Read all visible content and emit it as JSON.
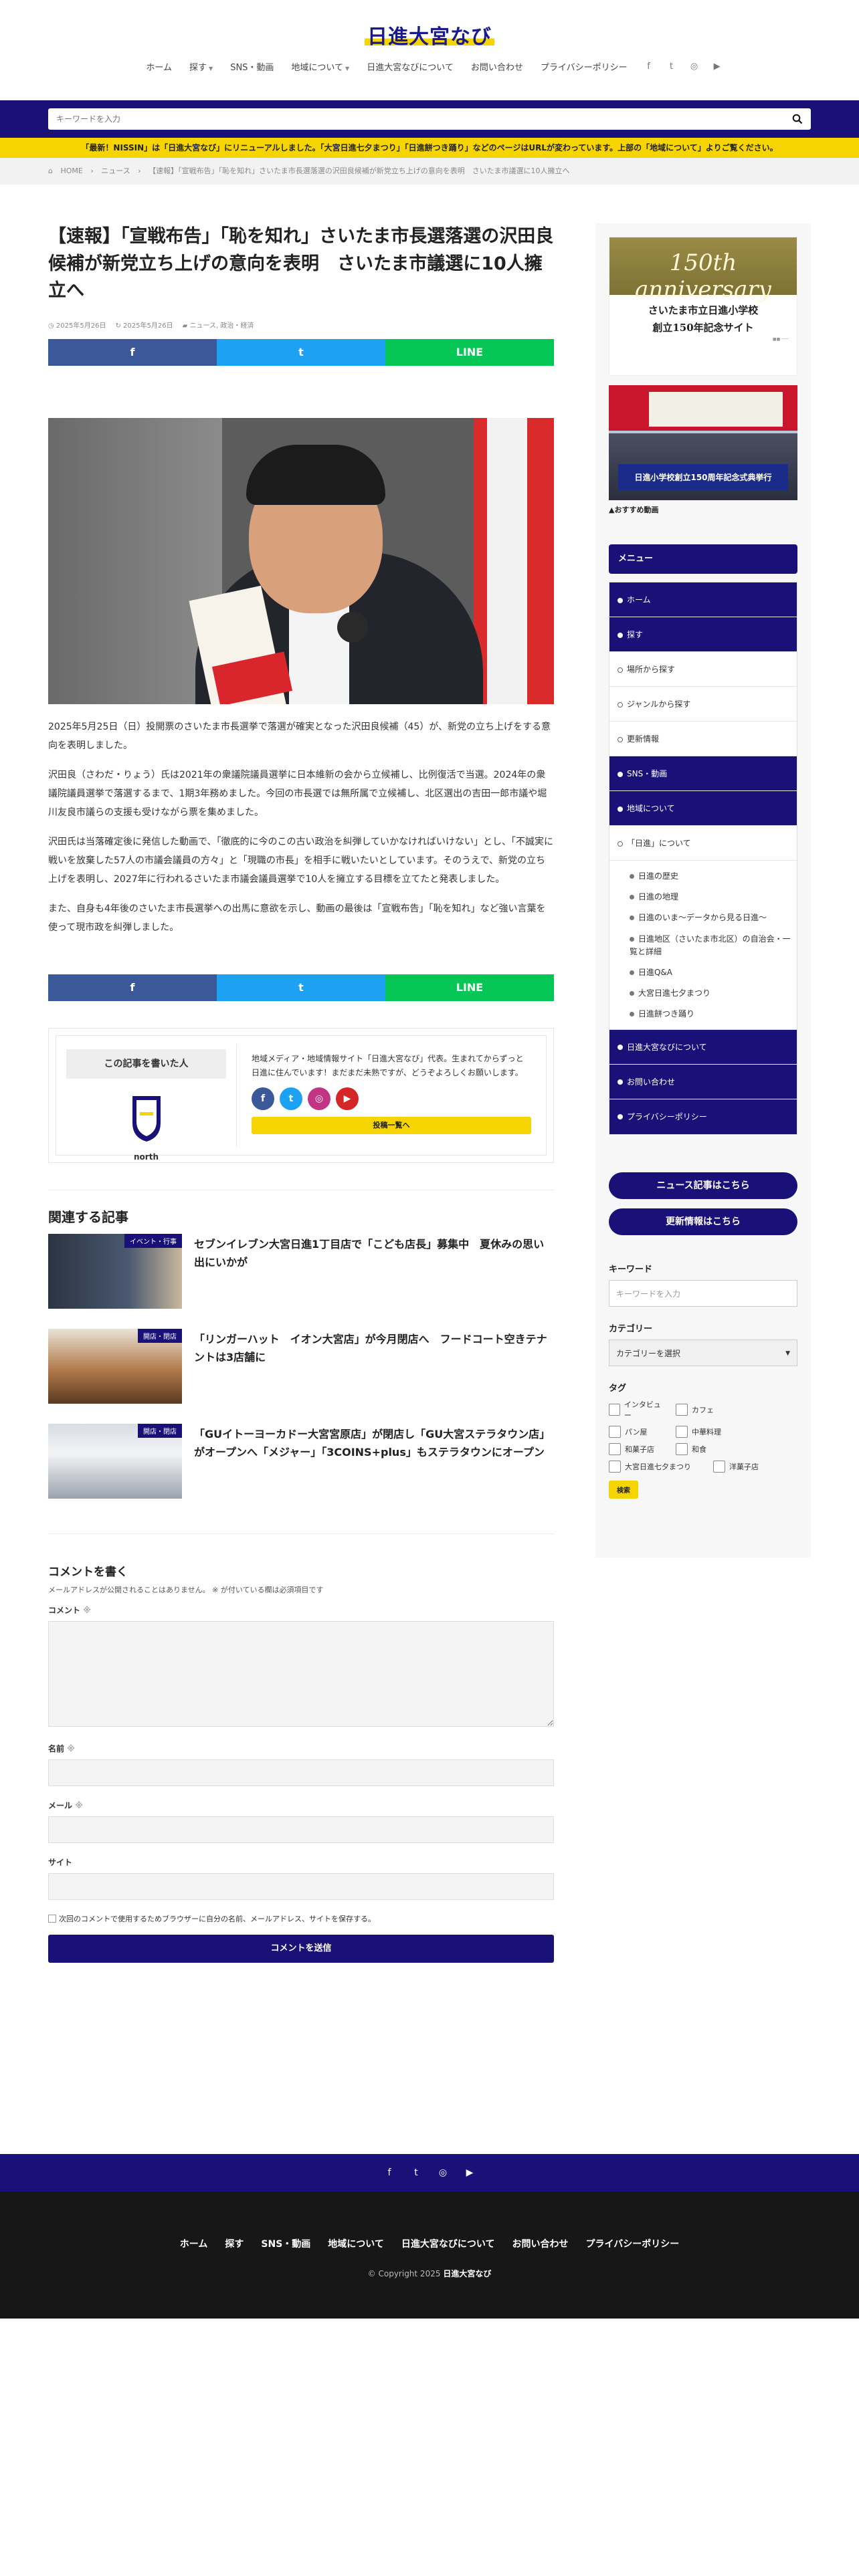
{
  "site": {
    "logo": "日進大宮なび",
    "nav": [
      "ホーム",
      "探す",
      "SNS・動画",
      "地域について",
      "日進大宮なびについて",
      "お問い合わせ",
      "プライバシーポリシー"
    ],
    "nav_has_dropdown": [
      false,
      true,
      false,
      true,
      false,
      false,
      false
    ],
    "sns_icons": [
      "facebook-icon",
      "twitter-icon",
      "instagram-icon",
      "youtube-icon"
    ]
  },
  "search": {
    "placeholder": "キーワードを入力"
  },
  "notice": "「最新！NISSIN」は「日進大宮なび」にリニューアルしました。「大宮日進七夕まつり」「日進餅つき踊り」などのページはURLが変わっています。上部の「地域について」よりご覧ください。",
  "breadcrumb": [
    "HOME",
    "ニュース",
    "【速報】「宣戦布告」「恥を知れ」さいたま市長選落選の沢田良候補が新党立ち上げの意向を表明　さいたま市議選に10人擁立へ"
  ],
  "article": {
    "title": "【速報】「宣戦布告」「恥を知れ」さいたま市長選落選の沢田良候補が新党立ち上げの意向を表明　さいたま市議選に10人擁立へ",
    "published": "2025年5月26日",
    "updated": "2025年5月26日",
    "category": "ニュース, 政治・経済",
    "paragraphs": [
      "2025年5月25日（日）投開票のさいたま市長選挙で落選が確実となった沢田良候補（45）が、新党の立ち上げをする意向を表明しました。",
      "沢田良（さわだ・りょう）氏は2021年の衆議院議員選挙に日本維新の会から立候補し、比例復活で当選。2024年の衆議院議員選挙で落選するまで、1期3年務めました。今回の市長選では無所属で立候補し、北区選出の吉田一郎市議や堀川友良市議らの支援も受けながら票を集めました。",
      "沢田氏は当落確定後に発信した動画で、「徹底的に今のこの古い政治を糾弾していかなければいけない」とし、「不誠実に戦いを放棄した57人の市議会議員の方々」と「現職の市長」を相手に戦いたいとしています。そのうえで、新党の立ち上げを表明し、2027年に行われるさいたま市議会議員選挙で10人を擁立する目標を立てたと発表しました。",
      "また、自身も4年後のさいたま市長選挙への出馬に意欲を示し、動画の最後は「宣戦布告」「恥を知れ」など強い言葉を使って現市政を糾弾しました。"
    ]
  },
  "author": {
    "label": "この記事を書いた人",
    "name": "north",
    "bio": "地域メディア・地域情報サイト「日進大宮なび」代表。生まれてからずっと日進に住んでいます！まだまだ未熟ですが、どうぞよろしくお願いします。",
    "posts_button": "投稿一覧へ"
  },
  "related": {
    "heading": "関連する記事",
    "items": [
      {
        "category": "イベント・行事",
        "title": "セブンイレブン大宮日進1丁目店で「こども店長」募集中　夏休みの思い出にいかが"
      },
      {
        "category": "開店・閉店",
        "title": "「リンガーハット　イオン大宮店」が今月閉店へ　フードコート空きテナントは3店舗に"
      },
      {
        "category": "開店・閉店",
        "title": "「GUイトーヨーカドー大宮宮原店」が閉店し「GU大宮ステラタウン店」がオープンへ「メジャー」「3COINS+plus」もステラタウンにオープン"
      }
    ]
  },
  "comment": {
    "heading": "コメントを書く",
    "note": "メールアドレスが公開されることはありません。 ※ が付いている欄は必須項目です",
    "comment_label": "コメント",
    "name_label": "名前",
    "mail_label": "メール",
    "site_label": "サイト",
    "required_mark": "※",
    "cookie": "次回のコメントで使用するためブラウザーに自分の名前、メールアドレス、サイトを保存する。",
    "submit": "コメントを送信"
  },
  "sidebar": {
    "banner_title": "150th anniversary",
    "banner_sub1": "さいたま市立日進小学校",
    "banner_sub2": "創立150年記念サイト",
    "video_caption": "日進小学校創立150周年記念式典挙行",
    "video_label": "▲おすすめ動画",
    "menu_heading": "メニュー",
    "menu": [
      {
        "label": "ホーム",
        "style": "dark"
      },
      {
        "label": "探す",
        "style": "dark"
      },
      {
        "label": "場所から探す",
        "style": "light"
      },
      {
        "label": "ジャンルから探す",
        "style": "light"
      },
      {
        "label": "更新情報",
        "style": "light"
      },
      {
        "label": "SNS・動画",
        "style": "dark"
      },
      {
        "label": "地域について",
        "style": "dark"
      },
      {
        "label": "「日進」について",
        "style": "light"
      }
    ],
    "submenu": [
      "日進の歴史",
      "日進の地理",
      "日進のいま〜データから見る日進〜",
      "日進地区（さいたま市北区）の自治会・一覧と詳細",
      "日進Q&A",
      "大宮日進七夕まつり",
      "日進餅つき踊り"
    ],
    "menu_after": [
      "日進大宮なびについて",
      "お問い合わせ",
      "プライバシーポリシー"
    ],
    "pill_news": "ニュース記事はこちら",
    "pill_updates": "更新情報はこちら",
    "keyword_heading": "キーワード",
    "keyword_placeholder": "キーワードを入力",
    "category_heading": "カテゴリー",
    "category_select": "カテゴリーを選択",
    "tag_heading": "タグ",
    "tags": [
      "インタビュー",
      "カフェ",
      "パン屋",
      "中華料理",
      "和菓子店",
      "和食",
      "大宮日進七夕まつり",
      "洋菓子店"
    ],
    "tag_button": "検索"
  },
  "footer": {
    "nav": [
      "ホーム",
      "探す",
      "SNS・動画",
      "地域について",
      "日進大宮なびについて",
      "お問い合わせ",
      "プライバシーポリシー"
    ],
    "copyright_prefix": "© Copyright 2025",
    "copyright_site": "日進大宮なび"
  },
  "colors": {
    "primary": "#1a1178",
    "accent": "#f5d400",
    "facebook": "#3b5998",
    "twitter": "#1da1f2",
    "line": "#06c755"
  }
}
